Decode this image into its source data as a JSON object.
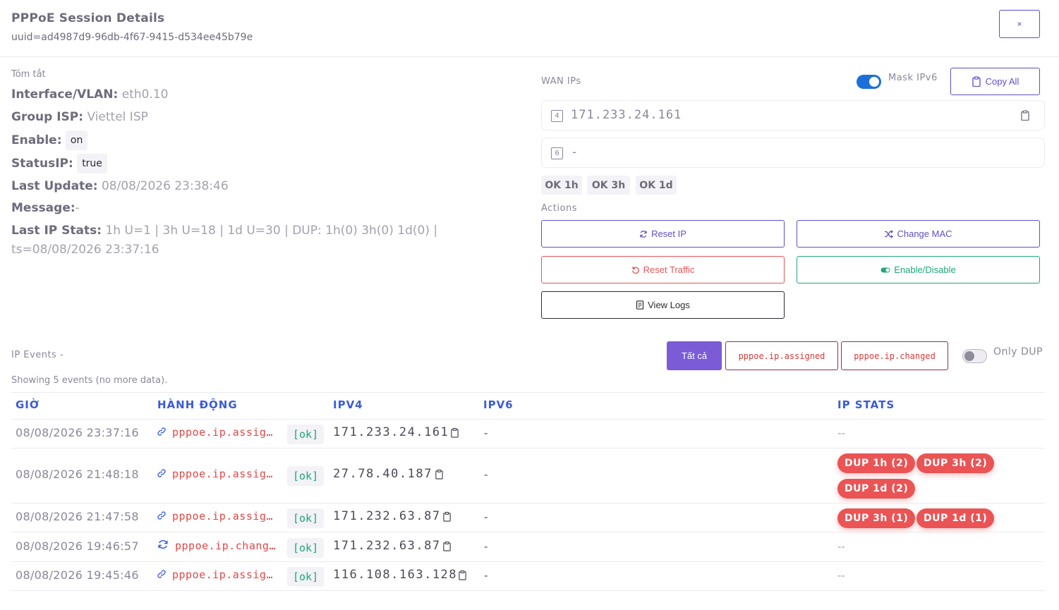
{
  "header": {
    "title": "PPPoE Session Details",
    "uuid": "uuid=ad4987d9-96db-4f67-9415-d534ee45b79e",
    "close_label": "×"
  },
  "summary": {
    "heading": "Tóm tắt",
    "interface_key": "Interface/VLAN:",
    "interface_val": "eth0.10",
    "group_key": "Group ISP:",
    "group_val": "Viettel ISP",
    "enable_key": "Enable:",
    "enable_val": "on",
    "statusip_key": "StatusIP:",
    "statusip_val": "true",
    "lastupdate_key": "Last Update:",
    "lastupdate_val": "08/08/2026 23:38:46",
    "message_key": "Message:",
    "message_val": "-",
    "laststats_key": "Last IP Stats:",
    "laststats_val": "1h U=1 | 3h U=18 | 1d U=30 | DUP: 1h(0) 3h(0) 1d(0) | ts=08/08/2026 23:37:16"
  },
  "wan": {
    "heading": "WAN IPs",
    "mask_label": "Mask IPv6",
    "copy_all_label": "Copy All",
    "ipv4_badge": "4",
    "ipv4_value": "171.233.24.161",
    "ipv6_badge": "6",
    "ipv6_value": "-",
    "ok_chips": [
      "OK 1h",
      "OK 3h",
      "OK 1d"
    ]
  },
  "actions": {
    "heading": "Actions",
    "reset_ip": "Reset IP",
    "change_mac": "Change MAC",
    "reset_traffic": "Reset Traffic",
    "enable_disable": "Enable/Disable",
    "view_logs": "View Logs"
  },
  "events": {
    "heading": "IP Events -",
    "filter_all": "Tất cả",
    "filter_assigned": "pppoe.ip.assigned",
    "filter_changed": "pppoe.ip.changed",
    "only_dup_label": "Only DUP",
    "showing": "Showing 5 events (no more data).",
    "columns": [
      "GIỜ",
      "HÀNH ĐỘNG",
      "IPV4",
      "IPV6",
      "IP STATS"
    ],
    "rows": [
      {
        "time": "08/08/2026 23:37:16",
        "action": "pppoe.ip.assigned",
        "status": "[ok]",
        "ipv4": "171.233.24.161",
        "ipv6": "-",
        "stats": "--",
        "dups": []
      },
      {
        "time": "08/08/2026 21:48:18",
        "action": "pppoe.ip.assigned",
        "status": "[ok]",
        "ipv4": "27.78.40.187",
        "ipv6": "-",
        "stats": "",
        "dups": [
          "DUP 1h (2)",
          "DUP 3h (2)",
          "DUP 1d (2)"
        ]
      },
      {
        "time": "08/08/2026 21:47:58",
        "action": "pppoe.ip.assigned",
        "status": "[ok]",
        "ipv4": "171.232.63.87",
        "ipv6": "-",
        "stats": "",
        "dups": [
          "DUP 3h (1)",
          "DUP 1d (1)"
        ]
      },
      {
        "time": "08/08/2026 19:46:57",
        "action": "pppoe.ip.changed",
        "status": "[ok]",
        "ipv4": "171.232.63.87",
        "ipv6": "-",
        "stats": "--",
        "dups": []
      },
      {
        "time": "08/08/2026 19:45:46",
        "action": "pppoe.ip.assigned",
        "status": "[ok]",
        "ipv4": "116.108.163.128",
        "ipv6": "-",
        "stats": "--",
        "dups": []
      }
    ]
  },
  "colors": {
    "primary": "#5e50c8",
    "danger": "#ea5455",
    "success": "#1fa67a",
    "link": "#3b5bdb"
  }
}
